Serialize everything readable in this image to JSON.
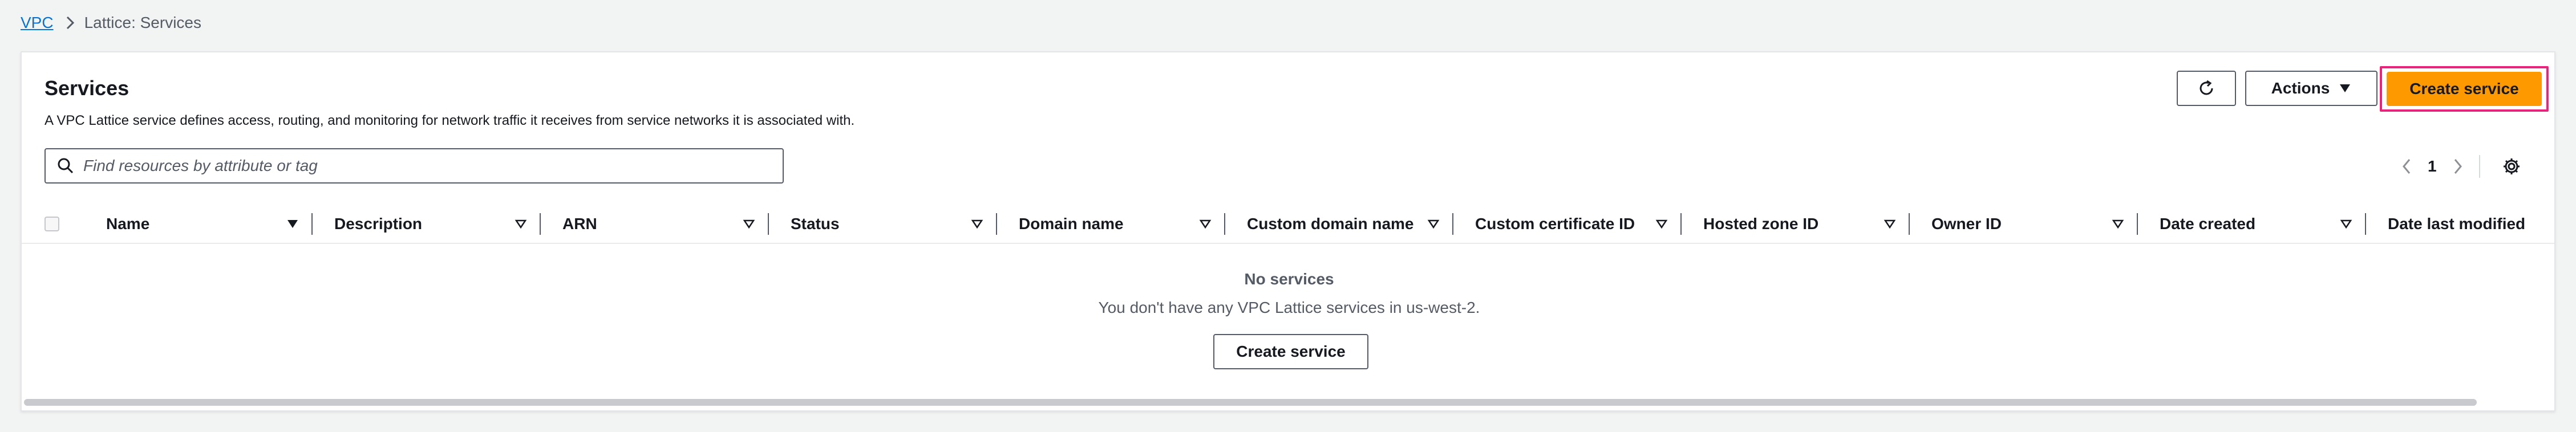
{
  "breadcrumb": {
    "root": "VPC",
    "current": "Lattice: Services"
  },
  "panel": {
    "title": "Services",
    "description": "A VPC Lattice service defines access, routing, and monitoring for network traffic it receives from service networks it is associated with."
  },
  "toolbar": {
    "refresh_icon": "refresh-icon",
    "actions_label": "Actions",
    "create_label": "Create service"
  },
  "search": {
    "placeholder": "Find resources by attribute or tag"
  },
  "pagination": {
    "current_page": "1"
  },
  "table": {
    "columns": [
      "Name",
      "Description",
      "ARN",
      "Status",
      "Domain name",
      "Custom domain name",
      "Custom certificate ID",
      "Hosted zone ID",
      "Owner ID",
      "Date created",
      "Date last modified"
    ]
  },
  "empty_state": {
    "title": "No services",
    "message": "You don't have any VPC Lattice services in us-west-2.",
    "button_label": "Create service"
  },
  "colors": {
    "primary": "#ff9900",
    "highlight": "#e8247c",
    "link": "#0972d3"
  }
}
